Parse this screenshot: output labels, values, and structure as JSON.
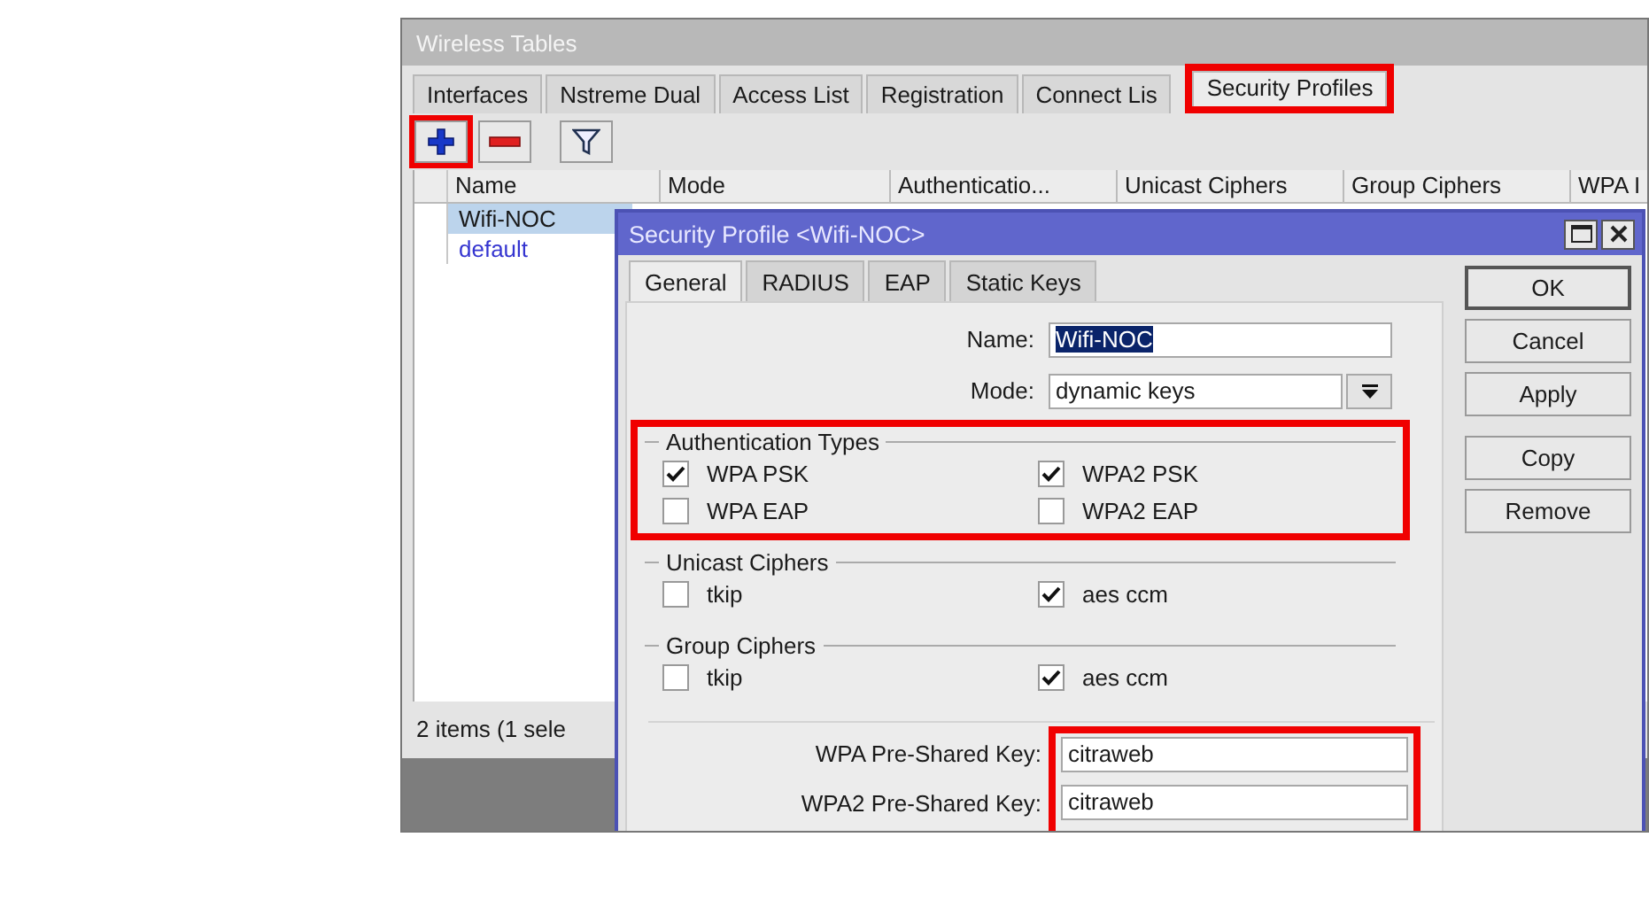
{
  "main_window": {
    "title": "Wireless Tables",
    "tabs": [
      {
        "label": "Interfaces",
        "selected": false,
        "highlighted": false
      },
      {
        "label": "Nstreme Dual",
        "selected": false,
        "highlighted": false
      },
      {
        "label": "Access List",
        "selected": false,
        "highlighted": false
      },
      {
        "label": "Registration",
        "selected": false,
        "highlighted": false
      },
      {
        "label": "Connect Lis",
        "selected": false,
        "highlighted": false
      },
      {
        "label": "Security Profiles",
        "selected": true,
        "highlighted": true
      }
    ],
    "toolbar": [
      {
        "kind": "add",
        "highlighted": true
      },
      {
        "kind": "remove",
        "highlighted": false
      },
      {
        "kind": "filter",
        "highlighted": false
      }
    ],
    "table": {
      "columns": [
        "Name",
        "Mode",
        "Authenticatio...",
        "Unicast Ciphers",
        "Group Ciphers",
        "WPA I"
      ],
      "rows": [
        {
          "name": "Wifi-NOC",
          "selected": true,
          "color": "#1a1a1a"
        },
        {
          "name": "default",
          "selected": false,
          "color": "#3535d0"
        }
      ]
    },
    "status": "2 items (1 sele"
  },
  "dialog": {
    "title": "Security Profile <Wifi-NOC>",
    "tabs": [
      {
        "label": "General",
        "selected": true
      },
      {
        "label": "RADIUS",
        "selected": false
      },
      {
        "label": "EAP",
        "selected": false
      },
      {
        "label": "Static Keys",
        "selected": false
      }
    ],
    "name": {
      "label": "Name:",
      "value": "Wifi-NOC",
      "value_selected": true
    },
    "mode": {
      "label": "Mode:",
      "value": "dynamic keys"
    },
    "groups": [
      {
        "title": "Authentication Types",
        "highlighted": true,
        "options": [
          {
            "label": "WPA PSK",
            "checked": true
          },
          {
            "label": "WPA2 PSK",
            "checked": true
          },
          {
            "label": "WPA EAP",
            "checked": false
          },
          {
            "label": "WPA2 EAP",
            "checked": false
          }
        ]
      },
      {
        "title": "Unicast Ciphers",
        "highlighted": false,
        "options": [
          {
            "label": "tkip",
            "checked": false
          },
          {
            "label": "aes ccm",
            "checked": true
          }
        ]
      },
      {
        "title": "Group Ciphers",
        "highlighted": false,
        "options": [
          {
            "label": "tkip",
            "checked": false
          },
          {
            "label": "aes ccm",
            "checked": true
          }
        ]
      }
    ],
    "keys": {
      "highlighted": true,
      "rows": [
        {
          "label": "WPA Pre-Shared Key:",
          "value": "citraweb"
        },
        {
          "label": "WPA2 Pre-Shared Key:",
          "value": "citraweb"
        }
      ]
    },
    "buttons": [
      {
        "label": "OK",
        "default": true
      },
      {
        "label": "Cancel",
        "default": false
      },
      {
        "label": "Apply",
        "default": false
      },
      {
        "label": "Copy",
        "default": false
      },
      {
        "label": "Remove",
        "default": false
      }
    ]
  }
}
